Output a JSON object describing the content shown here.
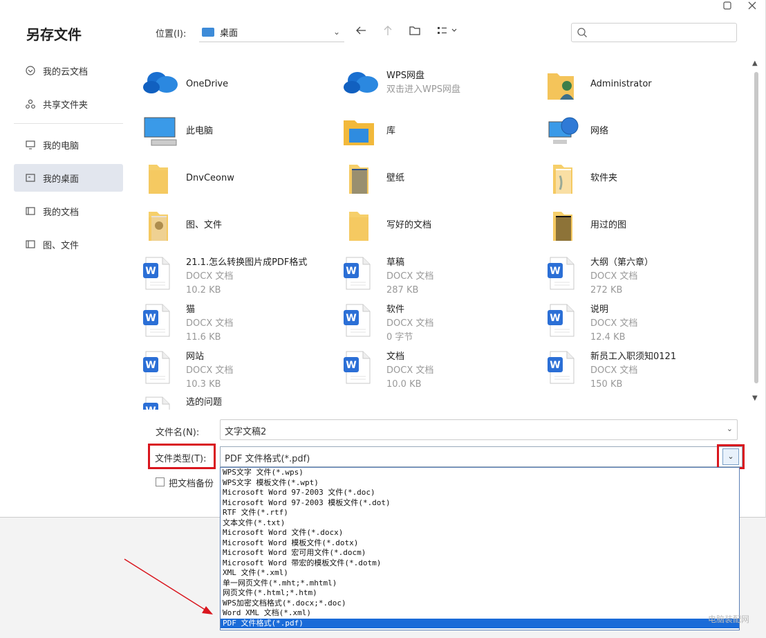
{
  "dialog": {
    "title": "另存文件",
    "restore_icon": "restore-icon",
    "close_icon": "close-icon"
  },
  "sidebar": {
    "items": [
      {
        "label": "我的云文档",
        "icon": "cloud-icon"
      },
      {
        "label": "共享文件夹",
        "icon": "share-icon"
      },
      {
        "label": "我的电脑",
        "icon": "computer-icon"
      },
      {
        "label": "我的桌面",
        "icon": "desktop-icon",
        "active": true
      },
      {
        "label": "我的文档",
        "icon": "folder-icon"
      },
      {
        "label": "图、文件",
        "icon": "folder-icon"
      }
    ]
  },
  "toolbar": {
    "location_label": "位置(I):",
    "location_value": "桌面",
    "search_placeholder": ""
  },
  "files": [
    {
      "name": "OneDrive",
      "sub1": "",
      "sub2": "",
      "kind": "onedrive"
    },
    {
      "name": "WPS网盘",
      "sub1": "双击进入WPS网盘",
      "sub2": "",
      "kind": "wpscloud"
    },
    {
      "name": "Administrator",
      "sub1": "",
      "sub2": "",
      "kind": "user"
    },
    {
      "name": "此电脑",
      "sub1": "",
      "sub2": "",
      "kind": "pc"
    },
    {
      "name": "库",
      "sub1": "",
      "sub2": "",
      "kind": "library"
    },
    {
      "name": "网络",
      "sub1": "",
      "sub2": "",
      "kind": "network"
    },
    {
      "name": "DnvCeonw",
      "sub1": "",
      "sub2": "",
      "kind": "folder"
    },
    {
      "name": "壁纸",
      "sub1": "",
      "sub2": "",
      "kind": "folder-img"
    },
    {
      "name": "软件夹",
      "sub1": "",
      "sub2": "",
      "kind": "folder-blue"
    },
    {
      "name": "图、文件",
      "sub1": "",
      "sub2": "",
      "kind": "folder-photo"
    },
    {
      "name": "写好的文档",
      "sub1": "",
      "sub2": "",
      "kind": "folder"
    },
    {
      "name": "用过的图",
      "sub1": "",
      "sub2": "",
      "kind": "folder-dark"
    },
    {
      "name": "21.1.怎么转换图片成PDF格式",
      "sub1": "DOCX 文档",
      "sub2": "10.2 KB",
      "kind": "doc"
    },
    {
      "name": "草稿",
      "sub1": "DOCX 文档",
      "sub2": "287 KB",
      "kind": "doc"
    },
    {
      "name": "大纲（第六章）",
      "sub1": "DOCX 文档",
      "sub2": "272 KB",
      "kind": "doc"
    },
    {
      "name": "猫",
      "sub1": "DOCX 文档",
      "sub2": "11.6 KB",
      "kind": "doc"
    },
    {
      "name": "软件",
      "sub1": "DOCX 文档",
      "sub2": "0 字节",
      "kind": "doc"
    },
    {
      "name": "说明",
      "sub1": "DOCX 文档",
      "sub2": "12.4 KB",
      "kind": "doc"
    },
    {
      "name": "网站",
      "sub1": "DOCX 文档",
      "sub2": "10.3 KB",
      "kind": "doc"
    },
    {
      "name": "文档",
      "sub1": "DOCX 文档",
      "sub2": "10.0 KB",
      "kind": "doc"
    },
    {
      "name": "新员工入职须知0121",
      "sub1": "DOCX 文档",
      "sub2": "150 KB",
      "kind": "doc"
    },
    {
      "name": "选的问题",
      "sub1": "",
      "sub2": "",
      "kind": "doc"
    }
  ],
  "form": {
    "filename_label": "文件名(N):",
    "filename_value": "文字文稿2",
    "filetype_label": "文件类型(T):",
    "filetype_value": "PDF 文件格式(*.pdf)",
    "backup_label": "把文档备份"
  },
  "filetype_options": [
    "WPS文字 文件(*.wps)",
    "WPS文字 模板文件(*.wpt)",
    "Microsoft Word 97-2003 文件(*.doc)",
    "Microsoft Word 97-2003 模板文件(*.dot)",
    "RTF 文件(*.rtf)",
    "文本文件(*.txt)",
    "Microsoft Word 文件(*.docx)",
    "Microsoft Word 模板文件(*.dotx)",
    "Microsoft Word 宏可用文件(*.docm)",
    "Microsoft Word 带宏的模板文件(*.dotm)",
    "XML 文件(*.xml)",
    "单一网页文件(*.mht;*.mhtml)",
    "网页文件(*.html;*.htm)",
    "WPS加密文档格式(*.docx;*.doc)",
    "Word XML 文档(*.xml)",
    "PDF 文件格式(*.pdf)"
  ],
  "selected_option_index": 15,
  "colors": {
    "highlight_red": "#d9161e",
    "selection_blue": "#1a6bd8",
    "word_blue": "#2b6fd6"
  },
  "watermark": "电脑装配网"
}
